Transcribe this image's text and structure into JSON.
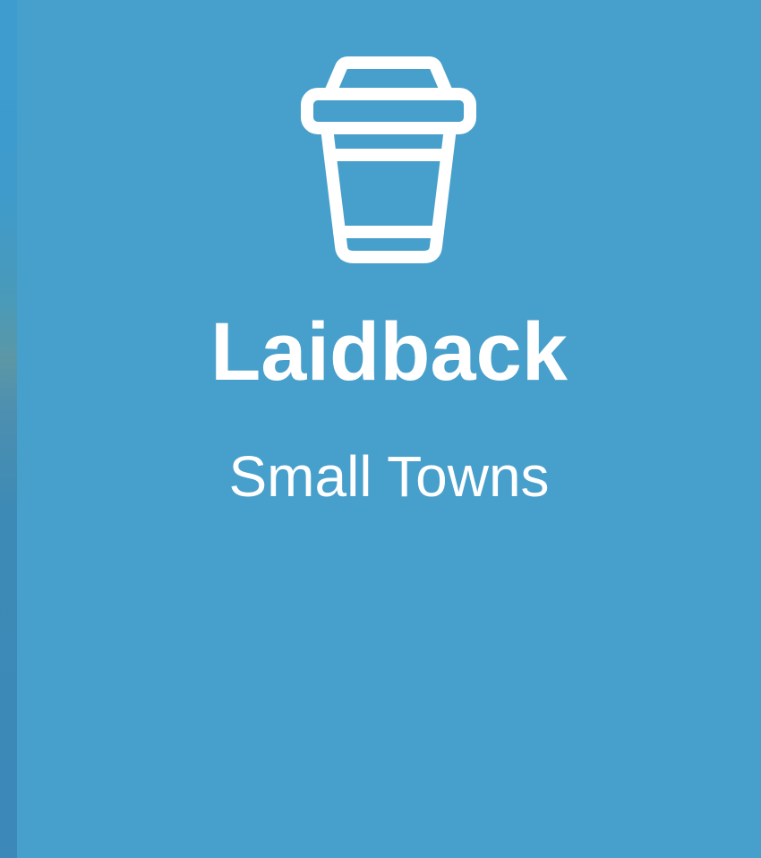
{
  "colors": {
    "background": "#479fcb",
    "foreground": "#ffffff"
  },
  "card": {
    "icon": "coffee-cup-icon",
    "title": "Laidback",
    "subtitle": "Small Towns"
  }
}
